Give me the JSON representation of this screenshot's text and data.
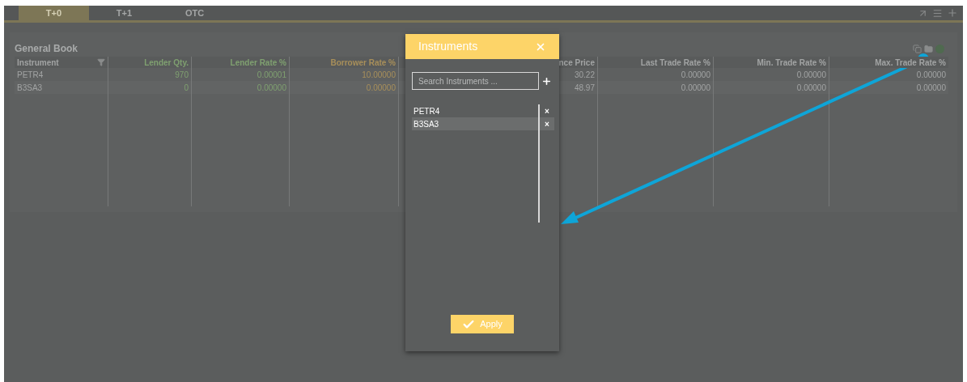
{
  "tabs": [
    {
      "label": "T+0",
      "selected": true
    },
    {
      "label": "T+1",
      "selected": false
    },
    {
      "label": "OTC",
      "selected": false
    }
  ],
  "book": {
    "title": "General Book",
    "columns": [
      {
        "label": "Instrument",
        "color": "#a2a4a4",
        "filter": true
      },
      {
        "label": "Lender Qty.",
        "color": "#7fa070",
        "filter": false
      },
      {
        "label": "Lender Rate %",
        "color": "#7fa070",
        "filter": false
      },
      {
        "label": "Borrower Rate %",
        "color": "#a88f5a",
        "filter": false
      },
      {
        "label": "nce Price",
        "color": "#a2a4a4",
        "filter": false
      },
      {
        "label": "Last Trade Rate %",
        "color": "#a2a4a4",
        "filter": false
      },
      {
        "label": "Min. Trade Rate %",
        "color": "#a2a4a4",
        "filter": false
      },
      {
        "label": "Max. Trade Rate %",
        "color": "#a2a4a4",
        "filter": false
      }
    ],
    "rows": [
      [
        "PETR4",
        "970",
        "0.00001",
        "10.00000",
        "30.22",
        "0.00000",
        "0.00000",
        "0.00000"
      ],
      [
        "B3SA3",
        "0",
        "0.00000",
        "0.00000",
        "48.97",
        "0.00000",
        "0.00000",
        "0.00000"
      ]
    ]
  },
  "dialog": {
    "title": "Instruments",
    "search": {
      "placeholder": "Search Instruments ..."
    },
    "items": [
      {
        "label": "PETR4",
        "selected": false
      },
      {
        "label": "B3SA3",
        "selected": true
      }
    ],
    "remove_mark": "×",
    "apply": "Apply"
  }
}
